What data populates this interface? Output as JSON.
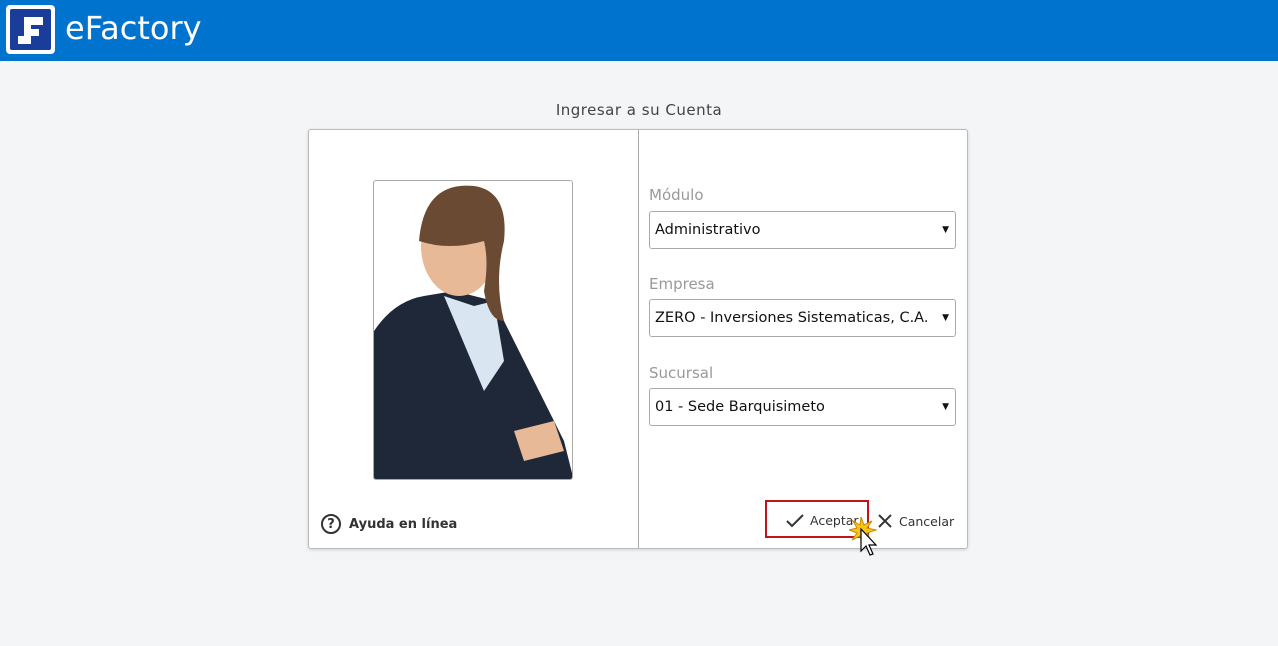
{
  "header": {
    "brand": "eFactory"
  },
  "page": {
    "title": "Ingresar a su Cuenta"
  },
  "help": {
    "label": "Ayuda en línea"
  },
  "form": {
    "modulo": {
      "label": "Módulo",
      "value": "Administrativo"
    },
    "empresa": {
      "label": "Empresa",
      "value": "ZERO - Inversiones Sistematicas, C.A."
    },
    "sucursal": {
      "label": "Sucursal",
      "value": "01 - Sede Barquisimeto"
    }
  },
  "actions": {
    "accept": "Aceptar",
    "cancel": "Cancelar"
  }
}
